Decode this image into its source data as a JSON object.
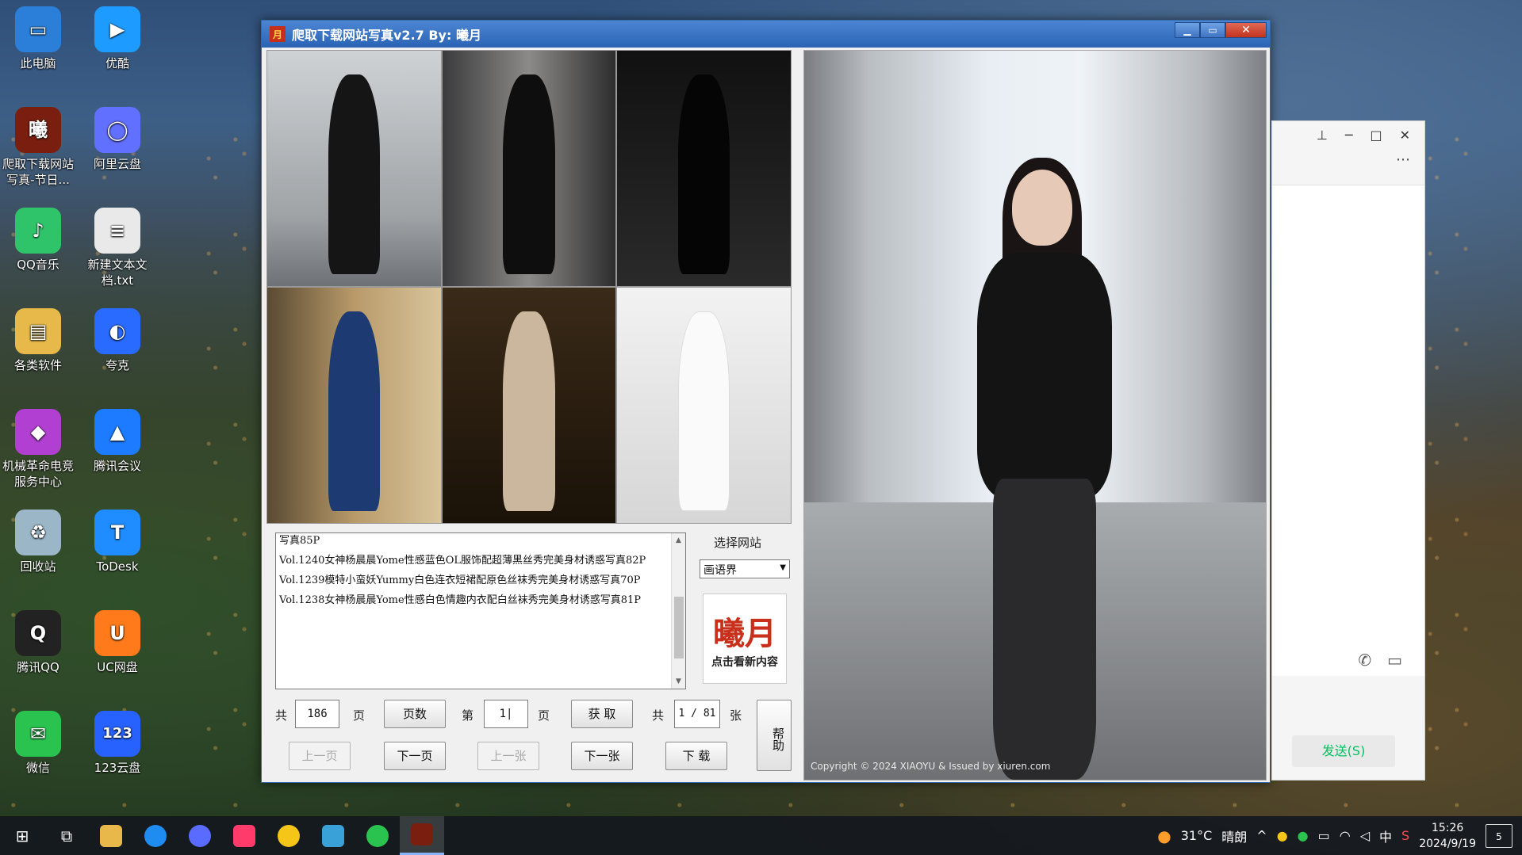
{
  "desktop": {
    "icons": [
      {
        "label": "此电脑",
        "color": "#2b7fd8",
        "icon": "computer-icon",
        "glyph": "▭"
      },
      {
        "label": "优酷",
        "color": "#1e9bff",
        "icon": "youku-icon",
        "glyph": "▶"
      },
      {
        "label": "爬取下载网站写真-节日...",
        "color": "#7a1f10",
        "icon": "xiaoyue-app-icon",
        "glyph": "曦"
      },
      {
        "label": "阿里云盘",
        "color": "#6270ff",
        "icon": "aliyun-drive-icon",
        "glyph": "◯"
      },
      {
        "label": "QQ音乐",
        "color": "#2fc46a",
        "icon": "qq-music-icon",
        "glyph": "♪"
      },
      {
        "label": "新建文本文档.txt",
        "color": "#e9e9e9",
        "icon": "text-file-icon",
        "glyph": "≡"
      },
      {
        "label": "各类软件",
        "color": "#e6b94a",
        "icon": "folder-icon",
        "glyph": "▤"
      },
      {
        "label": "夸克",
        "color": "#2a6bff",
        "icon": "quark-icon",
        "glyph": "◐"
      },
      {
        "label": "机械革命电竞服务中心",
        "color": "#b13fd1",
        "icon": "mechrevo-icon",
        "glyph": "◆"
      },
      {
        "label": "腾讯会议",
        "color": "#1c7bff",
        "icon": "tencent-meeting-icon",
        "glyph": "▲"
      },
      {
        "label": "回收站",
        "color": "#9ab6c7",
        "icon": "recycle-bin-icon",
        "glyph": "♻"
      },
      {
        "label": "ToDesk",
        "color": "#1f8cff",
        "icon": "todesk-icon",
        "glyph": "T"
      },
      {
        "label": "腾讯QQ",
        "color": "#222222",
        "icon": "qq-icon",
        "glyph": "Q"
      },
      {
        "label": "UC网盘",
        "color": "#ff7a1a",
        "icon": "uc-drive-icon",
        "glyph": "U"
      },
      {
        "label": "微信",
        "color": "#2ac34f",
        "icon": "wechat-icon",
        "glyph": "✉"
      },
      {
        "label": "123云盘",
        "color": "#2762ff",
        "icon": "123-cloud-icon",
        "glyph": "123"
      }
    ]
  },
  "app": {
    "title": "爬取下载网站写真v2.7   By: 曦月",
    "list_items": [
      "写真85P",
      "Vol.1240女神杨晨晨Yome性感蓝色OL服饰配超薄黑丝秀完美身材诱惑写真82P",
      "Vol.1239模特小蛮妖Yummy白色连衣短裙配原色丝袜秀完美身材诱惑写真70P",
      "Vol.1238女神杨晨晨Yome性感白色情趣内衣配白丝袜秀完美身材诱惑写真81P"
    ],
    "site_label": "选择网站",
    "site_selected": "画语界",
    "logo_main": "曦月",
    "logo_sub": "点击看新内容",
    "total_prefix": "共",
    "total_pages": "186",
    "page_unit": "页",
    "page_count_btn": "页数",
    "page_prefix": "第",
    "current_page": "1|",
    "page_unit2": "页",
    "fetch_btn": "获 取",
    "img_prefix": "共",
    "img_index": "1 / 81",
    "img_unit": "张",
    "help_btn": "帮助",
    "prev_page_btn": "上一页",
    "next_page_btn": "下一页",
    "prev_img_btn": "上一张",
    "next_img_btn": "下一张",
    "download_btn": "下 载",
    "preview_copyright": "Copyright © 2024 XIAOYU & Issued by xiuren.com"
  },
  "chat": {
    "send_label": "发送(S)"
  },
  "taskbar": {
    "weather_temp": "31°C",
    "weather_text": "晴朗",
    "ime": "中",
    "time": "15:26",
    "date": "2024/9/19",
    "notif_count": "5"
  }
}
